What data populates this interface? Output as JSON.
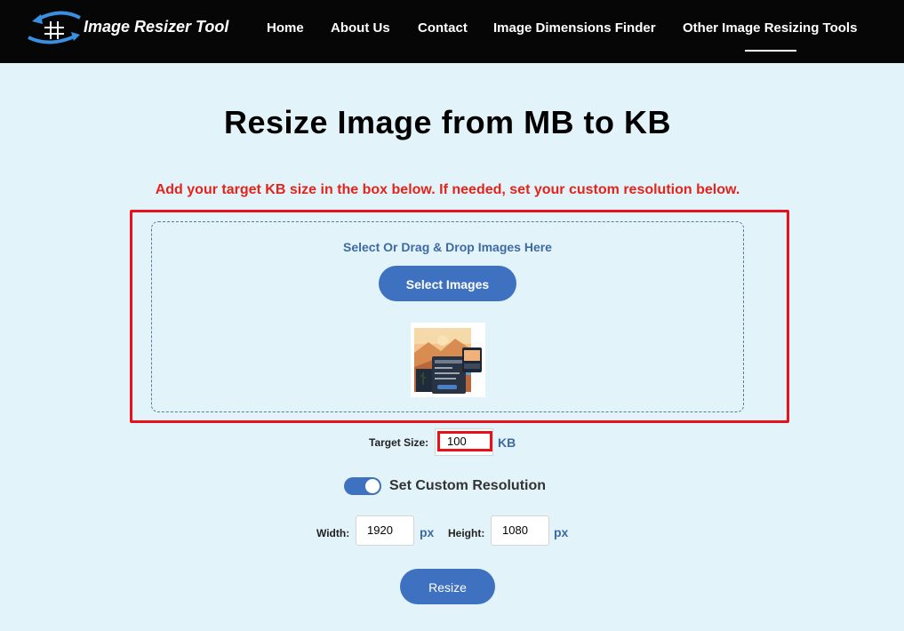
{
  "header": {
    "logo_text": "Image Resizer Tool",
    "nav": [
      {
        "label": "Home"
      },
      {
        "label": "About Us"
      },
      {
        "label": "Contact"
      },
      {
        "label": "Image Dimensions Finder"
      },
      {
        "label": "Other Image Resizing Tools",
        "active": true
      }
    ]
  },
  "main": {
    "title": "Resize Image from MB to KB",
    "instructions": "Add your target KB size in the box below. If needed, set your custom resolution below.",
    "dropzone": {
      "label": "Select Or Drag & Drop Images Here",
      "select_button": "Select Images"
    },
    "target_size": {
      "label": "Target Size:",
      "value": "100",
      "unit": "KB"
    },
    "custom_resolution": {
      "label": "Set Custom Resolution",
      "enabled": true
    },
    "width": {
      "label": "Width:",
      "value": "1920",
      "unit": "px"
    },
    "height": {
      "label": "Height:",
      "value": "1080",
      "unit": "px"
    },
    "resize_button": "Resize"
  },
  "colors": {
    "background": "#e3f3fa",
    "navbar": "#060606",
    "accent_blue": "#3e71c0",
    "highlight_red": "#e8101b",
    "instruction_red": "#e3241b"
  }
}
